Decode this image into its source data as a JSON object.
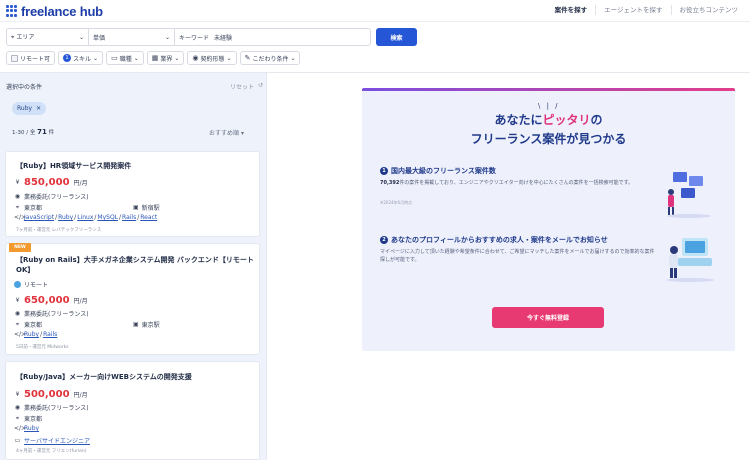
{
  "header": {
    "logo_text": "freelance hub",
    "nav": [
      "案件を探す",
      "エージェントを探す",
      "お役立ちコンテンツ"
    ]
  },
  "search": {
    "area_label": "エリア",
    "job_label": "単価",
    "keyword_label": "キーワード",
    "keyword_value": "未経験",
    "button_label": "検索"
  },
  "filters": {
    "remote_label": "リモート可",
    "skill_count": "1",
    "skill_label": "スキル",
    "position_label": "職種",
    "industry_label": "業界",
    "contract_label": "契約形態",
    "preference_label": "こだわり条件"
  },
  "selection": {
    "title": "選択中の条件",
    "reset_label": "リセット",
    "tag": "Ruby"
  },
  "results": {
    "range_label": "1-30 / 全",
    "total": "71",
    "unit": "件",
    "sort_label": "おすすめ順"
  },
  "jobs": [
    {
      "title": "【Ruby】HR領域サービス開発案件",
      "price": "850,000",
      "price_unit": "円/月",
      "contract": "業務委託(フリーランス)",
      "location": "東京都",
      "station": "新宿駅",
      "skills": [
        "JavaScript",
        "Ruby",
        "Linux",
        "MySQL",
        "Rails",
        "React"
      ],
      "footer": "7ヶ月前・運営元 レバテックフリーランス"
    },
    {
      "badge": "NEW",
      "title": "【Ruby on Rails】大手メガネ企業システム開発 バックエンド【リモートOK】",
      "remote": "リモート",
      "price": "650,000",
      "price_unit": "円/月",
      "contract": "業務委託(フリーランス)",
      "location": "東京都",
      "station": "東京駅",
      "skills": [
        "Ruby",
        "Rails"
      ],
      "footer": "5日前・運営元 Midworks"
    },
    {
      "title": "【Ruby/Java】メーカー向けWEBシステムの開発支援",
      "price": "500,000",
      "price_unit": "円/月",
      "contract": "業務委託(フリーランス)",
      "location": "東京都",
      "skills": [
        "Ruby"
      ],
      "position": "サーバサイドエンジニア",
      "footer": "4ヶ月前・運営元 フリエン(furien)"
    }
  ],
  "promo": {
    "headline_pre": "あなたに",
    "headline_accent": "ピッタリ",
    "headline_post": "の",
    "headline_line2": "フリーランス案件が見つかる",
    "feature1_num": "1",
    "feature1_title": "国内最大級のフリーランス案件数",
    "feature1_count": "70,392",
    "feature1_text": "件の案件を掲載しており、エンジニアやクリエイター向けを中心にたくさんの案件を一括検索可能です。",
    "feature1_note": "※2024年6月時点",
    "feature2_num": "2",
    "feature2_title": "あなたのプロフィールからおすすめの求人・案件をメールでお知らせ",
    "feature2_text": "マイページに入力して頂いた経験や希望条件に合わせて、ご希望にマッチした案件をメールでお届けするので効率的な案件探しが可能です。",
    "cta_label": "今すぐ無料登録"
  }
}
